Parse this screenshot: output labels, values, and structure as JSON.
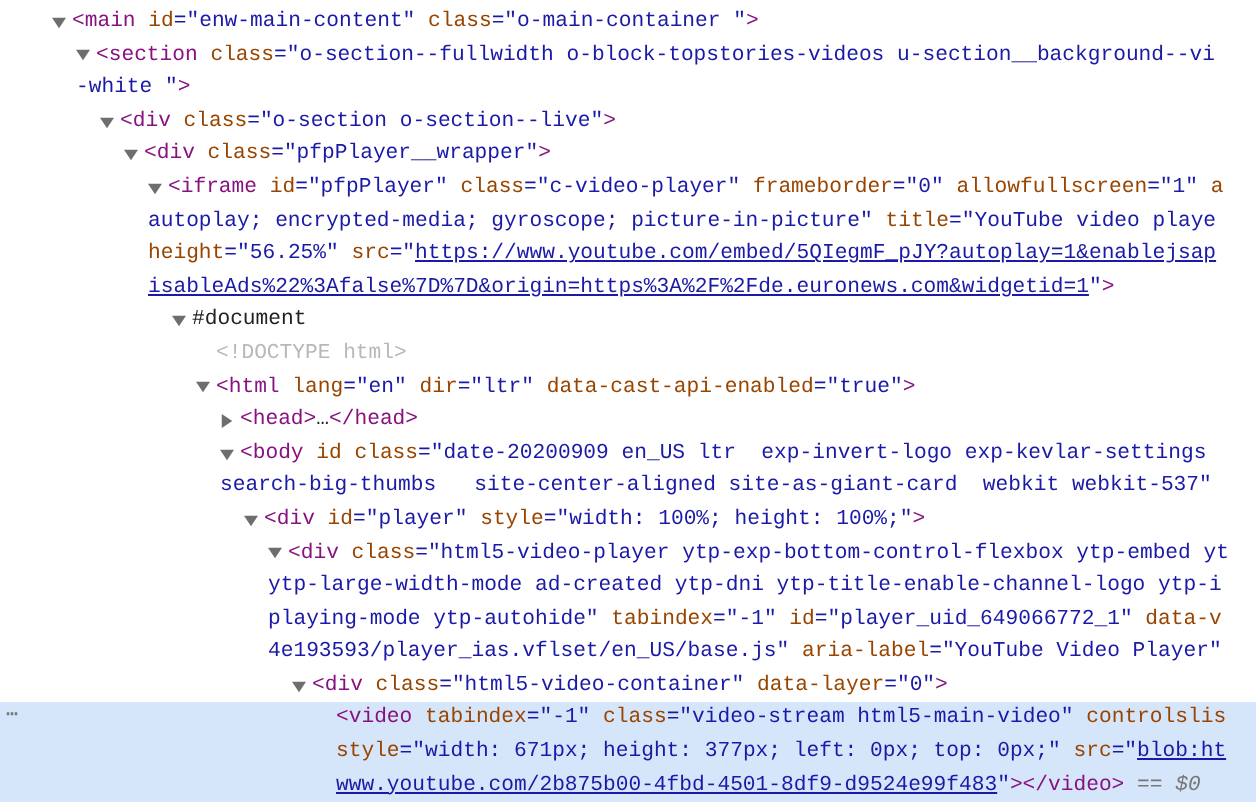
{
  "tree": [
    {
      "expanded": true,
      "selected": false,
      "lines": [
        [
          {
            "kind": "tag",
            "text": "<main"
          },
          {
            "kind": "attr",
            "text": " id"
          },
          {
            "kind": "value",
            "text": "=\"enw-main-content\""
          },
          {
            "kind": "attr",
            "text": " class"
          },
          {
            "kind": "value",
            "text": "=\"o-main-container \""
          },
          {
            "kind": "tag",
            "text": ">"
          }
        ]
      ],
      "children": [
        {
          "expanded": true,
          "selected": false,
          "lines": [
            [
              {
                "kind": "tag",
                "text": "<section"
              },
              {
                "kind": "attr",
                "text": " class"
              },
              {
                "kind": "value",
                "text": "=\"o-section--fullwidth o-block-topstories-videos u-section__background--vi"
              }
            ],
            [
              {
                "kind": "value",
                "text": "-white \""
              },
              {
                "kind": "tag",
                "text": ">"
              }
            ]
          ],
          "children": [
            {
              "expanded": true,
              "selected": false,
              "lines": [
                [
                  {
                    "kind": "tag",
                    "text": "<div"
                  },
                  {
                    "kind": "attr",
                    "text": " class"
                  },
                  {
                    "kind": "value",
                    "text": "=\"o-section o-section--live\""
                  },
                  {
                    "kind": "tag",
                    "text": ">"
                  }
                ]
              ],
              "children": [
                {
                  "expanded": true,
                  "selected": false,
                  "lines": [
                    [
                      {
                        "kind": "tag",
                        "text": "<div"
                      },
                      {
                        "kind": "attr",
                        "text": " class"
                      },
                      {
                        "kind": "value",
                        "text": "=\"pfpPlayer__wrapper\""
                      },
                      {
                        "kind": "tag",
                        "text": ">"
                      }
                    ]
                  ],
                  "children": [
                    {
                      "expanded": true,
                      "selected": false,
                      "lines": [
                        [
                          {
                            "kind": "tag",
                            "text": "<iframe"
                          },
                          {
                            "kind": "attr",
                            "text": " id"
                          },
                          {
                            "kind": "value",
                            "text": "=\"pfpPlayer\""
                          },
                          {
                            "kind": "attr",
                            "text": " class"
                          },
                          {
                            "kind": "value",
                            "text": "=\"c-video-player\""
                          },
                          {
                            "kind": "attr",
                            "text": " frameborder"
                          },
                          {
                            "kind": "value",
                            "text": "=\"0\""
                          },
                          {
                            "kind": "attr",
                            "text": " allowfullscreen"
                          },
                          {
                            "kind": "value",
                            "text": "=\"1\""
                          },
                          {
                            "kind": "attr",
                            "text": " a"
                          }
                        ],
                        [
                          {
                            "kind": "value",
                            "text": "autoplay; encrypted-media; gyroscope; picture-in-picture\""
                          },
                          {
                            "kind": "attr",
                            "text": " title"
                          },
                          {
                            "kind": "value",
                            "text": "=\"YouTube video playe"
                          }
                        ],
                        [
                          {
                            "kind": "attr",
                            "text": "height"
                          },
                          {
                            "kind": "value",
                            "text": "=\"56.25%\""
                          },
                          {
                            "kind": "attr",
                            "text": " src"
                          },
                          {
                            "kind": "value",
                            "text": "=\""
                          },
                          {
                            "kind": "link",
                            "text": "https://www.youtube.com/embed/5QIegmF_pJY?autoplay=1&enablejsap"
                          }
                        ],
                        [
                          {
                            "kind": "link",
                            "text": "isableAds%22%3Afalse%7D%7D&origin=https%3A%2F%2Fde.euronews.com&widgetid=1"
                          },
                          {
                            "kind": "value",
                            "text": "\""
                          },
                          {
                            "kind": "tag",
                            "text": ">"
                          }
                        ]
                      ],
                      "children": [
                        {
                          "expanded": true,
                          "selected": false,
                          "lines": [
                            [
                              {
                                "kind": "text",
                                "text": "#document"
                              }
                            ]
                          ],
                          "children": [
                            {
                              "selected": false,
                              "lines": [
                                [
                                  {
                                    "kind": "doctype",
                                    "text": "<!DOCTYPE html>"
                                  }
                                ]
                              ]
                            },
                            {
                              "expanded": true,
                              "selected": false,
                              "lines": [
                                [
                                  {
                                    "kind": "tag",
                                    "text": "<html"
                                  },
                                  {
                                    "kind": "attr",
                                    "text": " lang"
                                  },
                                  {
                                    "kind": "value",
                                    "text": "=\"en\""
                                  },
                                  {
                                    "kind": "attr",
                                    "text": " dir"
                                  },
                                  {
                                    "kind": "value",
                                    "text": "=\"ltr\""
                                  },
                                  {
                                    "kind": "attr",
                                    "text": " data-cast-api-enabled"
                                  },
                                  {
                                    "kind": "value",
                                    "text": "=\"true\""
                                  },
                                  {
                                    "kind": "tag",
                                    "text": ">"
                                  }
                                ]
                              ],
                              "children": [
                                {
                                  "expanded": false,
                                  "selected": false,
                                  "lines": [
                                    [
                                      {
                                        "kind": "tag",
                                        "text": "<head>"
                                      },
                                      {
                                        "kind": "text",
                                        "text": "…"
                                      },
                                      {
                                        "kind": "tag",
                                        "text": "</head>"
                                      }
                                    ]
                                  ]
                                },
                                {
                                  "expanded": true,
                                  "selected": false,
                                  "lines": [
                                    [
                                      {
                                        "kind": "tag",
                                        "text": "<body"
                                      },
                                      {
                                        "kind": "attr",
                                        "text": " id"
                                      },
                                      {
                                        "kind": "attr",
                                        "text": " class"
                                      },
                                      {
                                        "kind": "value",
                                        "text": "=\"date-20200909 en_US ltr  exp-invert-logo exp-kevlar-settings"
                                      }
                                    ],
                                    [
                                      {
                                        "kind": "value",
                                        "text": "search-big-thumbs   site-center-aligned site-as-giant-card  webkit webkit-537\""
                                      }
                                    ]
                                  ],
                                  "children": [
                                    {
                                      "expanded": true,
                                      "selected": false,
                                      "lines": [
                                        [
                                          {
                                            "kind": "tag",
                                            "text": "<div"
                                          },
                                          {
                                            "kind": "attr",
                                            "text": " id"
                                          },
                                          {
                                            "kind": "value",
                                            "text": "=\"player\""
                                          },
                                          {
                                            "kind": "attr",
                                            "text": " style"
                                          },
                                          {
                                            "kind": "value",
                                            "text": "=\"width: 100%; height: 100%;\""
                                          },
                                          {
                                            "kind": "tag",
                                            "text": ">"
                                          }
                                        ]
                                      ],
                                      "children": [
                                        {
                                          "expanded": true,
                                          "selected": false,
                                          "lines": [
                                            [
                                              {
                                                "kind": "tag",
                                                "text": "<div"
                                              },
                                              {
                                                "kind": "attr",
                                                "text": " class"
                                              },
                                              {
                                                "kind": "value",
                                                "text": "=\"html5-video-player ytp-exp-bottom-control-flexbox ytp-embed yt"
                                              }
                                            ],
                                            [
                                              {
                                                "kind": "value",
                                                "text": "ytp-large-width-mode ad-created ytp-dni ytp-title-enable-channel-logo ytp-i"
                                              }
                                            ],
                                            [
                                              {
                                                "kind": "value",
                                                "text": "playing-mode ytp-autohide\""
                                              },
                                              {
                                                "kind": "attr",
                                                "text": " tabindex"
                                              },
                                              {
                                                "kind": "value",
                                                "text": "=\"-1\""
                                              },
                                              {
                                                "kind": "attr",
                                                "text": " id"
                                              },
                                              {
                                                "kind": "value",
                                                "text": "=\"player_uid_649066772_1\""
                                              },
                                              {
                                                "kind": "attr",
                                                "text": " data-v"
                                              }
                                            ],
                                            [
                                              {
                                                "kind": "value",
                                                "text": "4e193593/player_ias.vflset/en_US/base.js\""
                                              },
                                              {
                                                "kind": "attr",
                                                "text": " aria-label"
                                              },
                                              {
                                                "kind": "value",
                                                "text": "=\"YouTube Video Player\""
                                              }
                                            ]
                                          ],
                                          "children": [
                                            {
                                              "expanded": true,
                                              "selected": false,
                                              "lines": [
                                                [
                                                  {
                                                    "kind": "tag",
                                                    "text": "<div"
                                                  },
                                                  {
                                                    "kind": "attr",
                                                    "text": " class"
                                                  },
                                                  {
                                                    "kind": "value",
                                                    "text": "=\"html5-video-container\""
                                                  },
                                                  {
                                                    "kind": "attr",
                                                    "text": " data-layer"
                                                  },
                                                  {
                                                    "kind": "value",
                                                    "text": "=\"0\""
                                                  },
                                                  {
                                                    "kind": "tag",
                                                    "text": ">"
                                                  }
                                                ]
                                              ],
                                              "children": [
                                                {
                                                  "selected": true,
                                                  "menu_glyph": "⋯",
                                                  "lines": [
                                                    [
                                                      {
                                                        "kind": "tag",
                                                        "text": "<video"
                                                      },
                                                      {
                                                        "kind": "attr",
                                                        "text": " tabindex"
                                                      },
                                                      {
                                                        "kind": "value",
                                                        "text": "=\"-1\""
                                                      },
                                                      {
                                                        "kind": "attr",
                                                        "text": " class"
                                                      },
                                                      {
                                                        "kind": "value",
                                                        "text": "=\"video-stream html5-main-video\""
                                                      },
                                                      {
                                                        "kind": "attr",
                                                        "text": " controlslis"
                                                      }
                                                    ],
                                                    [
                                                      {
                                                        "kind": "attr",
                                                        "text": "style"
                                                      },
                                                      {
                                                        "kind": "value",
                                                        "text": "=\"width: 671px; height: 377px; left: 0px; top: 0px;\""
                                                      },
                                                      {
                                                        "kind": "attr",
                                                        "text": " src"
                                                      },
                                                      {
                                                        "kind": "value",
                                                        "text": "=\""
                                                      },
                                                      {
                                                        "kind": "link",
                                                        "text": "blob:ht"
                                                      }
                                                    ],
                                                    [
                                                      {
                                                        "kind": "link",
                                                        "text": "www.youtube.com/2b875b00-4fbd-4501-8df9-d9524e99f483"
                                                      },
                                                      {
                                                        "kind": "value",
                                                        "text": "\""
                                                      },
                                                      {
                                                        "kind": "tag",
                                                        "text": "></video>"
                                                      },
                                                      {
                                                        "kind": "marker",
                                                        "text": " == $0"
                                                      }
                                                    ]
                                                  ]
                                                }
                                              ]
                                            }
                                          ]
                                        }
                                      ]
                                    }
                                  ]
                                }
                              ]
                            }
                          ]
                        }
                      ]
                    }
                  ]
                }
              ]
            }
          ]
        }
      ]
    }
  ]
}
